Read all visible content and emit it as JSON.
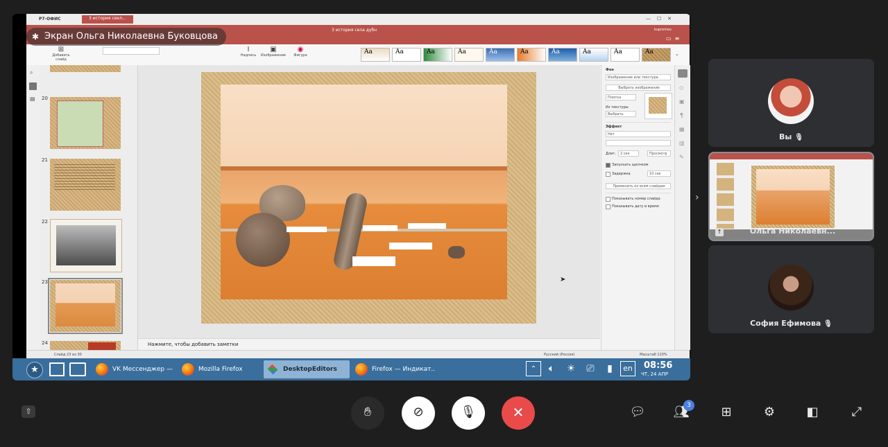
{
  "presenter_label": "Экран Ольга Николаевна Буковцова",
  "app": {
    "vendor": "Р7-ОФИС",
    "tab": "3 история сеел...",
    "doc_title": "3 история села дубн",
    "user": "kupromov",
    "toolbar": {
      "add_slide": "Добавить слайд",
      "heading": "Надпись",
      "image": "Изображение",
      "shape": "Фигура"
    },
    "slides": [
      {
        "num": "20"
      },
      {
        "num": "21"
      },
      {
        "num": "22"
      },
      {
        "num": "23"
      },
      {
        "num": "24"
      }
    ],
    "notes_placeholder": "Нажмите, чтобы добавить заметки",
    "right": {
      "fill_header": "Фон",
      "fill_type": "Изображение или текстура",
      "choose_image": "Выбрать изображение",
      "tile": "Плитка",
      "from_texture": "Из текстуры",
      "choose": "Выбрать",
      "effect_header": "Эффект",
      "effect_value": "Нет",
      "duration_label": "Длит.",
      "duration_value": "2 сек",
      "preview": "Просмотр",
      "on_click": "Запускать щелчком",
      "delay": "Задержка",
      "delay_value": "10 сек",
      "apply_all": "Применить ко всем слайдам",
      "show_number": "Показывать номер слайда",
      "show_date": "Показывать дату и время"
    },
    "status": {
      "slide_of": "Слайд 23 из 30",
      "lang": "Русский (Россия)",
      "zoom": "Масштаб 110%"
    }
  },
  "taskbar": {
    "items": [
      "VK Мессенджер —",
      "Mozilla Firefox",
      "DesktopEditors",
      "Firefox — Индикат.."
    ],
    "lang": "en",
    "time": "08:56",
    "date": "ЧТ, 24 АПР"
  },
  "participants": [
    {
      "name": "Вы"
    },
    {
      "name": "Ольга Николаевн..."
    },
    {
      "name": "София Ефимова"
    }
  ],
  "badge_count": "3",
  "colors": {
    "background": "#1e1e1e",
    "docbar": "#b9524b",
    "taskbar": "#3a6e9c",
    "hangup": "#e94b4b",
    "badge": "#4a7fe0"
  },
  "icons": [
    "hand-icon",
    "camera-off-icon",
    "mic-off-icon",
    "close-icon",
    "chat-icon",
    "people-icon",
    "grid-icon",
    "gear-icon",
    "layout-icon",
    "fullscreen-icon",
    "share-icon"
  ]
}
